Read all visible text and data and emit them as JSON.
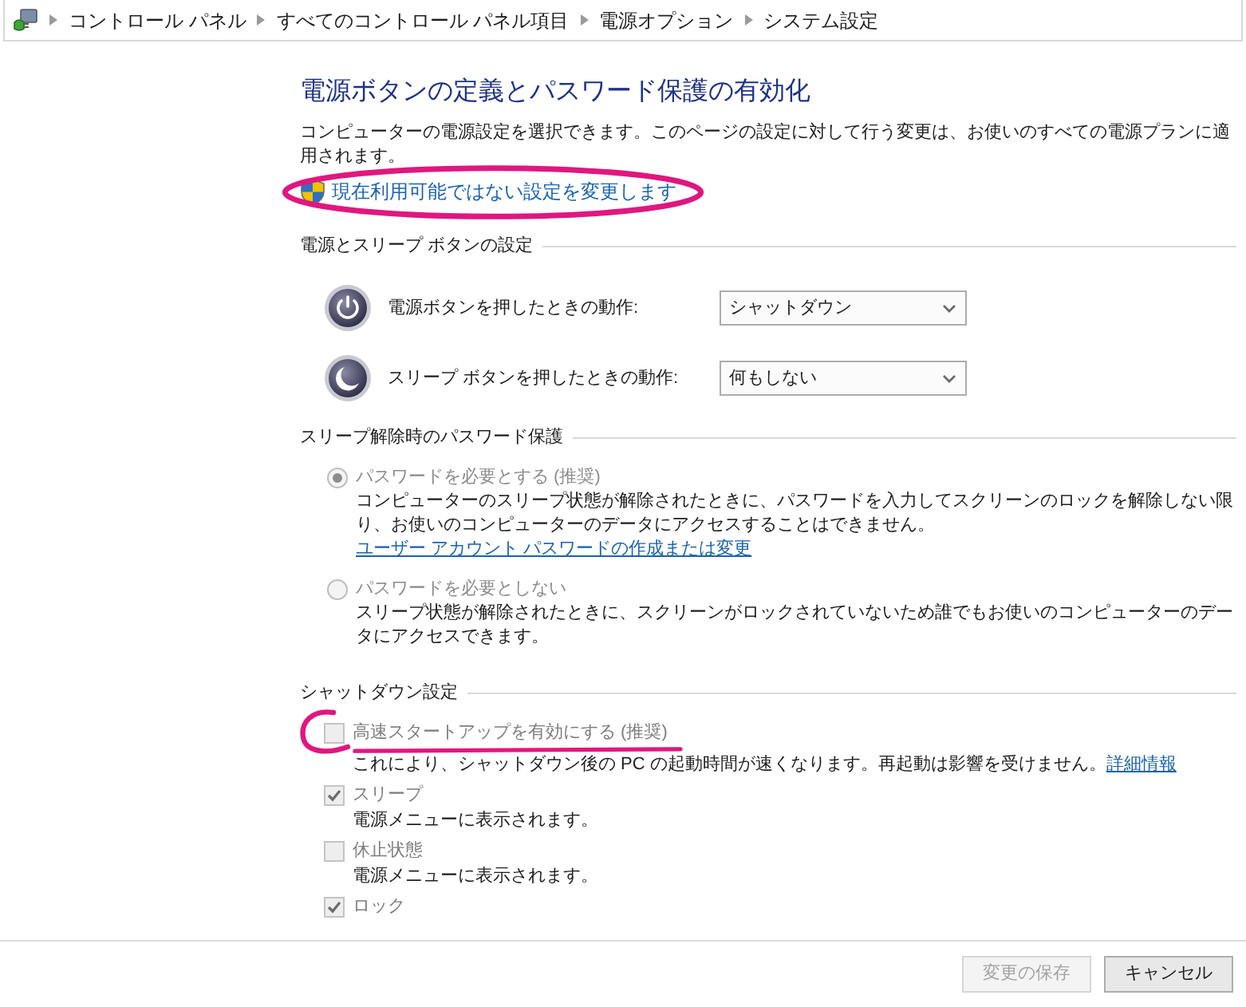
{
  "breadcrumb": [
    "コントロール パネル",
    "すべてのコントロール パネル項目",
    "電源オプション",
    "システム設定"
  ],
  "title": "電源ボタンの定義とパスワード保護の有効化",
  "description": "コンピューターの電源設定を選択できます。このページの設定に対して行う変更は、お使いのすべての電源プランに適用されます。",
  "elevate_link": {
    "label": "現在利用可能ではない設定を変更します",
    "circled": true
  },
  "power_section": {
    "heading": "電源とスリープ ボタンの設定",
    "rows": [
      {
        "kind": "power",
        "label": "電源ボタンを押したときの動作:",
        "value": "シャットダウン"
      },
      {
        "kind": "sleep",
        "label": "スリープ ボタンを押したときの動作:",
        "value": "何もしない"
      }
    ]
  },
  "password_section": {
    "heading": "スリープ解除時のパスワード保護",
    "options": [
      {
        "label": "パスワードを必要とする (推奨)",
        "selected": true,
        "disabled": true,
        "description": "コンピューターのスリープ状態が解除されたときに、パスワードを入力してスクリーンのロックを解除しない限り、お使いのコンピューターのデータにアクセスすることはできません。",
        "link": "ユーザー アカウント パスワードの作成または変更"
      },
      {
        "label": "パスワードを必要としない",
        "selected": false,
        "disabled": true,
        "description": "スリープ状態が解除されたときに、スクリーンがロックされていないため誰でもお使いのコンピューターのデータにアクセスできます。"
      }
    ]
  },
  "shutdown_section": {
    "heading": "シャットダウン設定",
    "options": [
      {
        "label": "高速スタートアップを有効にする (推奨)",
        "checked": false,
        "disabled": true,
        "pen_mark": true,
        "description": "これにより、シャットダウン後の PC の起動時間が速くなります。再起動は影響を受けません。",
        "link": "詳細情報"
      },
      {
        "label": "スリープ",
        "checked": true,
        "disabled": true,
        "pen_mark": false,
        "description": "電源メニューに表示されます。"
      },
      {
        "label": "休止状態",
        "checked": false,
        "disabled": true,
        "pen_mark": false,
        "description": "電源メニューに表示されます。"
      },
      {
        "label": "ロック",
        "checked": true,
        "disabled": true,
        "pen_mark": false
      }
    ]
  },
  "buttons": [
    {
      "label": "変更の保存",
      "disabled": true
    },
    {
      "label": "キャンセル",
      "disabled": false
    }
  ]
}
